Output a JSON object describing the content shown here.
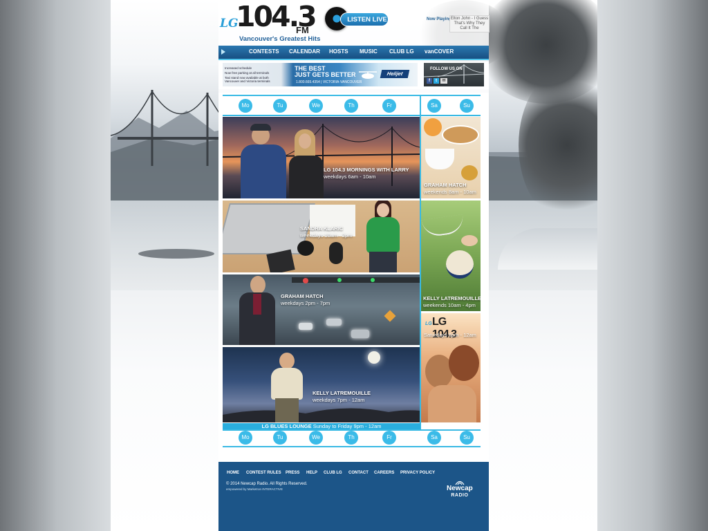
{
  "header": {
    "logo": {
      "prefix": "LG",
      "number": "104.3",
      "fm": "FM",
      "tagline": "Vancouver's Greatest Hits"
    },
    "listen_live": "LISTEN LIVE",
    "now_playing": {
      "label": "Now Playing:",
      "song": "Elton John - I Guess That's Why They Call It The"
    }
  },
  "nav": {
    "items": [
      "CONTESTS",
      "CALENDAR",
      "HOSTS",
      "MUSIC",
      "CLUB LG",
      "vanCOVER"
    ]
  },
  "ads": {
    "helijet": {
      "bullets": [
        "Increased schedule",
        "Now free parking at all terminals",
        "Taxi stand now available at both Vancouver and Victoria terminals"
      ],
      "headline_1": "THE BEST",
      "headline_2": "JUST GETS BETTER",
      "phone": "1.800.665.4354 | VICTORIA·VANCOUVER",
      "brand": "Helijet"
    },
    "follow": {
      "label": "FOLLOW US ON",
      "icons": [
        "facebook-icon",
        "twitter-icon",
        "email-icon"
      ]
    }
  },
  "schedule": {
    "weekdays": [
      "Mo",
      "Tu",
      "We",
      "Th",
      "Fr"
    ],
    "weekend": [
      "Sa",
      "Su"
    ],
    "weekday_shows": [
      {
        "name": "LG 104.3 MORNINGS WITH LARRY",
        "time": "weekdays 6am - 10am"
      },
      {
        "name": "SANDRA KLARIC",
        "time": "weekdays 10am - 2pm"
      },
      {
        "name": "GRAHAM HATCH",
        "time": "weekdays 2pm - 7pm"
      },
      {
        "name": "KELLY LATREMOUILLE",
        "time": "weekdays 7pm - 12am"
      }
    ],
    "weekend_shows": [
      {
        "name": "GRAHAM HATCH",
        "time": "weekends 8am - 10am"
      },
      {
        "name": "KELLY LATREMOUILLE",
        "time": "weekends 10am - 4pm"
      },
      {
        "name": "",
        "time": "Saturdays 6pm - 12am",
        "logo": "LG 104.3"
      }
    ],
    "blues_lounge": {
      "name": "LG BLUES LOUNGE",
      "time": "Sunday to Friday 9pm - 12am"
    }
  },
  "footer": {
    "links": [
      "HOME",
      "CONTEST RULES",
      "PRESS",
      "HELP",
      "CLUB LG",
      "CONTACT",
      "CAREERS",
      "PRIVACY POLICY"
    ],
    "copyright": "© 2014 Newcap Radio. All Rights Reserved.",
    "powered": "empowered by Marketron INTERACTIVE",
    "brand": {
      "name": "Newcap",
      "sub": "RADIO"
    }
  }
}
